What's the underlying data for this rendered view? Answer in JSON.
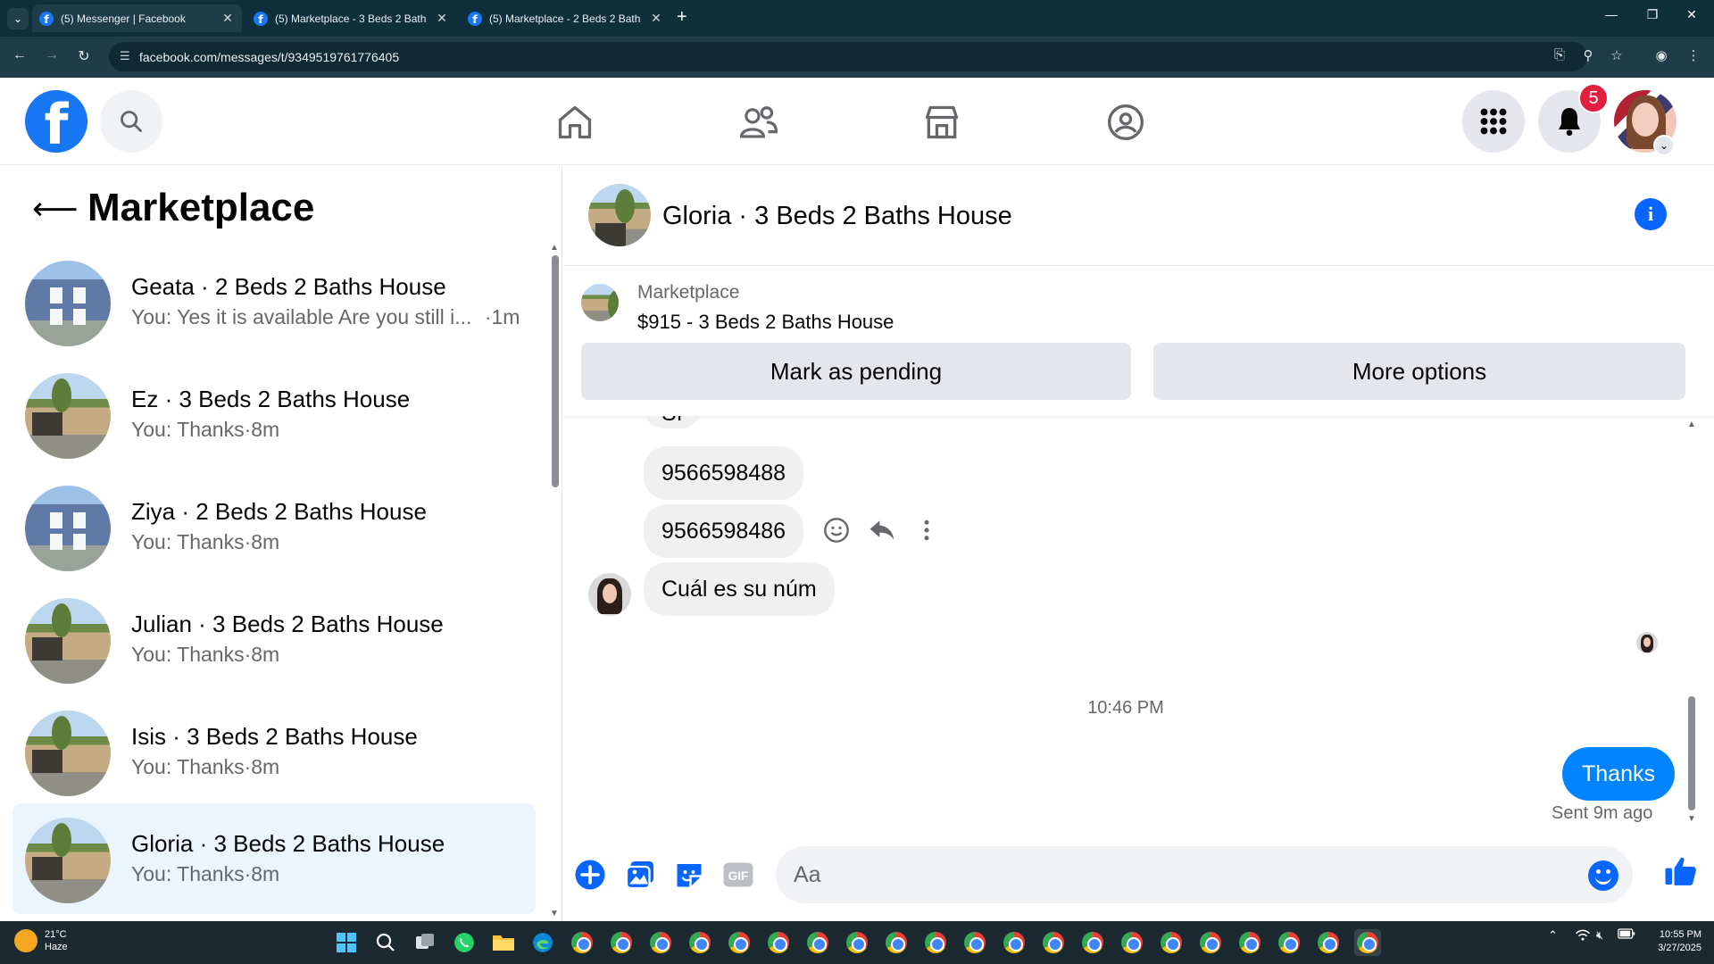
{
  "browser": {
    "tabs": [
      {
        "title": "(5) Messenger | Facebook",
        "active": true
      },
      {
        "title": "(5) Marketplace - 3 Beds 2 Bath",
        "active": false
      },
      {
        "title": "(5) Marketplace - 2 Beds 2 Bath",
        "active": false
      }
    ],
    "url": "facebook.com/messages/t/9349519761776405"
  },
  "fb_header": {
    "notification_count": "5"
  },
  "left_panel": {
    "title": "Marketplace",
    "conversations": [
      {
        "name": "Geata · 2 Beds 2 Baths House",
        "preview": "You: Yes it is available Are you still i...",
        "time": "·1m",
        "thumb": "house-blue",
        "selected": false
      },
      {
        "name": "Ez · 3 Beds 2 Baths House",
        "preview": "You: Thanks",
        "time": "·8m",
        "thumb": "house-brown",
        "selected": false
      },
      {
        "name": "Ziya · 2 Beds 2 Baths House",
        "preview": "You: Thanks",
        "time": "·8m",
        "thumb": "house-blue",
        "selected": false
      },
      {
        "name": "Julian · 3 Beds 2 Baths House",
        "preview": "You: Thanks",
        "time": "·8m",
        "thumb": "house-brown",
        "selected": false
      },
      {
        "name": "Isis · 3 Beds 2 Baths House",
        "preview": "You: Thanks",
        "time": "·8m",
        "thumb": "house-brown",
        "selected": false
      },
      {
        "name": "Gloria · 3 Beds 2 Baths House",
        "preview": "You: Thanks",
        "time": "·8m",
        "thumb": "house-brown",
        "selected": true
      }
    ]
  },
  "conversation": {
    "title": "Gloria · 3 Beds 2 Baths House",
    "listing_source": "Marketplace",
    "listing_price_title": "$915 - 3 Beds 2 Baths House",
    "mark_pending_label": "Mark as pending",
    "more_options_label": "More options",
    "messages": {
      "partial": "Sí",
      "phone1": "9566598488",
      "phone2": "9566598486",
      "question": "Cuál es su núm"
    },
    "timestamp": "10:46 PM",
    "sent_message": "Thanks",
    "sent_status": "Sent 9m ago",
    "composer_placeholder": "Aa"
  },
  "taskbar": {
    "temperature": "21°C",
    "weather": "Haze",
    "time": "10:55 PM",
    "date": "3/27/2025"
  },
  "colors": {
    "fb_blue": "#1877f2",
    "messenger_blue": "#0084ff",
    "selected_bg": "#ebf5ff",
    "badge_red": "#e41e3f"
  }
}
